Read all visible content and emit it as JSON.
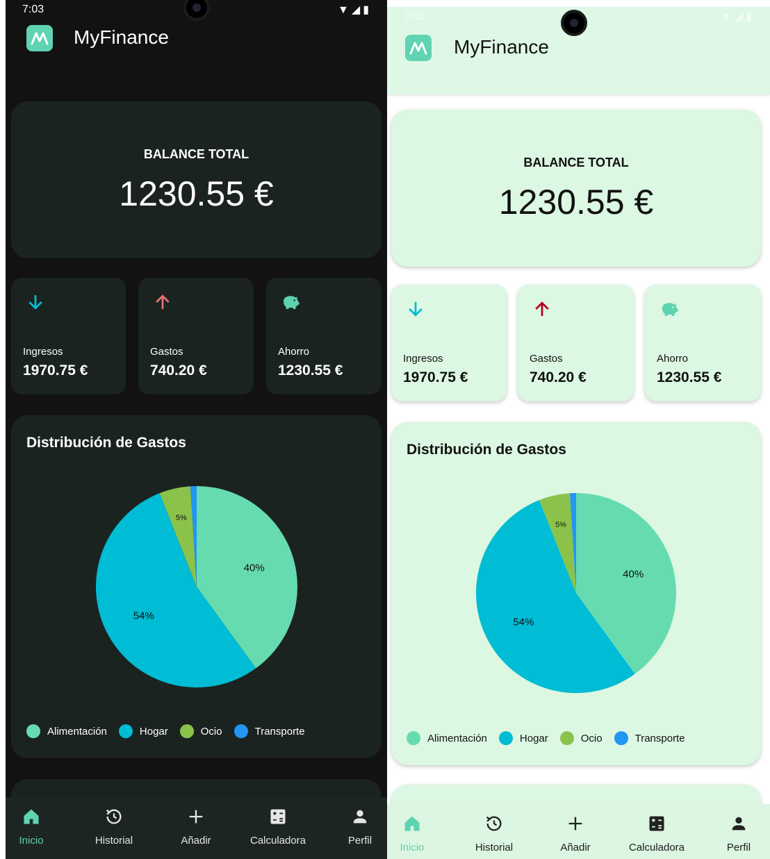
{
  "app": {
    "title": "MyFinance"
  },
  "status": {
    "time": "7:03"
  },
  "balance": {
    "label": "BALANCE TOTAL",
    "value": "1230.55 €"
  },
  "summary": [
    {
      "label": "Ingresos",
      "value": "1970.75 €",
      "icon": "arrow-down-icon",
      "color": "#00bcd4"
    },
    {
      "label": "Gastos",
      "value": "740.20 €",
      "icon": "arrow-up-icon",
      "color": "#e57373"
    },
    {
      "label": "Ahorro",
      "value": "1230.55 €",
      "icon": "piggy-bank-icon",
      "color": "#5ed3b1"
    }
  ],
  "distribution": {
    "title": "Distribución de Gastos"
  },
  "chart_data": {
    "type": "pie",
    "title": "Distribución de Gastos",
    "categories": [
      "Alimentación",
      "Hogar",
      "Ocio",
      "Transporte"
    ],
    "values": [
      40,
      54,
      5,
      1
    ],
    "labels": [
      "40%",
      "54%",
      "5%",
      ""
    ],
    "colors": [
      "#66dbb0",
      "#00bcd4",
      "#8bc34a",
      "#2196f3"
    ],
    "legend": "bottom"
  },
  "nav": [
    {
      "label": "Inicio",
      "icon": "home-icon",
      "active": true
    },
    {
      "label": "Historial",
      "icon": "history-icon",
      "active": false
    },
    {
      "label": "Añadir",
      "icon": "plus-icon",
      "active": false
    },
    {
      "label": "Calculadora",
      "icon": "calculator-icon",
      "active": false
    },
    {
      "label": "Perfil",
      "icon": "person-icon",
      "active": false
    }
  ],
  "theme": {
    "dark_bg": "#121212",
    "dark_card": "#1b2321",
    "light_bg": "#dff8e5",
    "accent": "#5ed3b1"
  }
}
